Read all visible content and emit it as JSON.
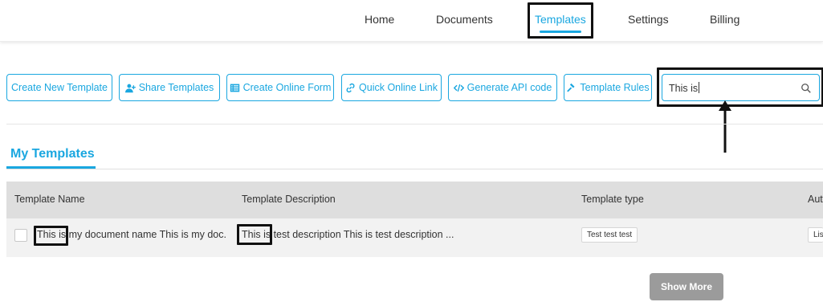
{
  "nav": {
    "home": "Home",
    "documents": "Documents",
    "templates": "Templates",
    "settings": "Settings",
    "billing": "Billing"
  },
  "toolbar": {
    "create_new_template": "Create New Template",
    "share_templates": "Share Templates",
    "create_online_form": "Create Online Form",
    "quick_online_link": "Quick Online Link",
    "generate_api_code": "Generate API code",
    "template_rules": "Template Rules",
    "search_value": "This is"
  },
  "section": {
    "title": "My Templates"
  },
  "table": {
    "headers": [
      "Template Name",
      "Template Description",
      "Template type",
      "Aut"
    ],
    "rows": [
      {
        "name": "This is my document name This is my doc...",
        "description": "This is test description This is test description ...",
        "type": "Test test test",
        "extra": "Lis"
      }
    ]
  },
  "show_more": "Show More",
  "colors": {
    "accent": "#1aa7e0",
    "header_bg": "#dedede",
    "row_bg": "#f2f2f2",
    "button_gray": "#9b9b9b"
  }
}
